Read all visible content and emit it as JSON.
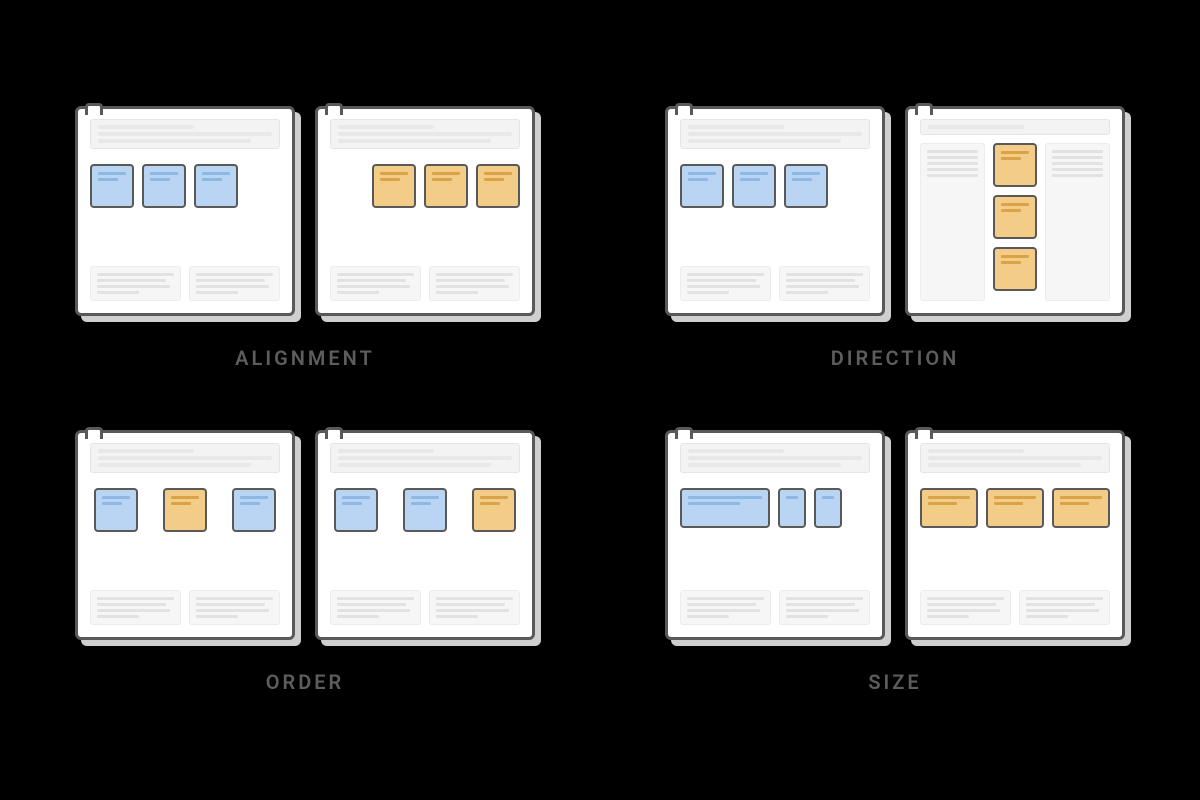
{
  "concepts": [
    {
      "id": "alignment",
      "label": "ALIGNMENT"
    },
    {
      "id": "direction",
      "label": "DIRECTION"
    },
    {
      "id": "order",
      "label": "ORDER"
    },
    {
      "id": "size",
      "label": "SIZE"
    }
  ],
  "colors": {
    "blue_fill": "#b9d5f3",
    "orange_fill": "#f3cd87",
    "outline": "#595959",
    "shadow": "#cfcfcf",
    "text": "#5d5d5d"
  },
  "diagrams": {
    "alignment": {
      "left": {
        "layout": "row-left",
        "items": [
          {
            "color": "blue"
          },
          {
            "color": "blue"
          },
          {
            "color": "blue"
          }
        ]
      },
      "right": {
        "layout": "row-right",
        "items": [
          {
            "color": "orange"
          },
          {
            "color": "orange"
          },
          {
            "color": "orange"
          }
        ]
      }
    },
    "direction": {
      "left": {
        "layout": "row-left",
        "items": [
          {
            "color": "blue"
          },
          {
            "color": "blue"
          },
          {
            "color": "blue"
          }
        ]
      },
      "right": {
        "layout": "column-center",
        "items": [
          {
            "color": "orange"
          },
          {
            "color": "orange"
          },
          {
            "color": "orange"
          }
        ]
      }
    },
    "order": {
      "left": {
        "layout": "row-spread",
        "items": [
          {
            "color": "blue"
          },
          {
            "color": "orange"
          },
          {
            "color": "blue"
          }
        ]
      },
      "right": {
        "layout": "row-spread",
        "items": [
          {
            "color": "blue"
          },
          {
            "color": "blue"
          },
          {
            "color": "orange"
          }
        ]
      }
    },
    "size": {
      "left": {
        "layout": "row-left",
        "items": [
          {
            "color": "blue",
            "size": "wide"
          },
          {
            "color": "blue",
            "size": "narrow"
          },
          {
            "color": "blue",
            "size": "narrow"
          }
        ]
      },
      "right": {
        "layout": "row-center",
        "items": [
          {
            "color": "orange",
            "size": "third"
          },
          {
            "color": "orange",
            "size": "third"
          },
          {
            "color": "orange",
            "size": "third"
          }
        ]
      }
    }
  }
}
